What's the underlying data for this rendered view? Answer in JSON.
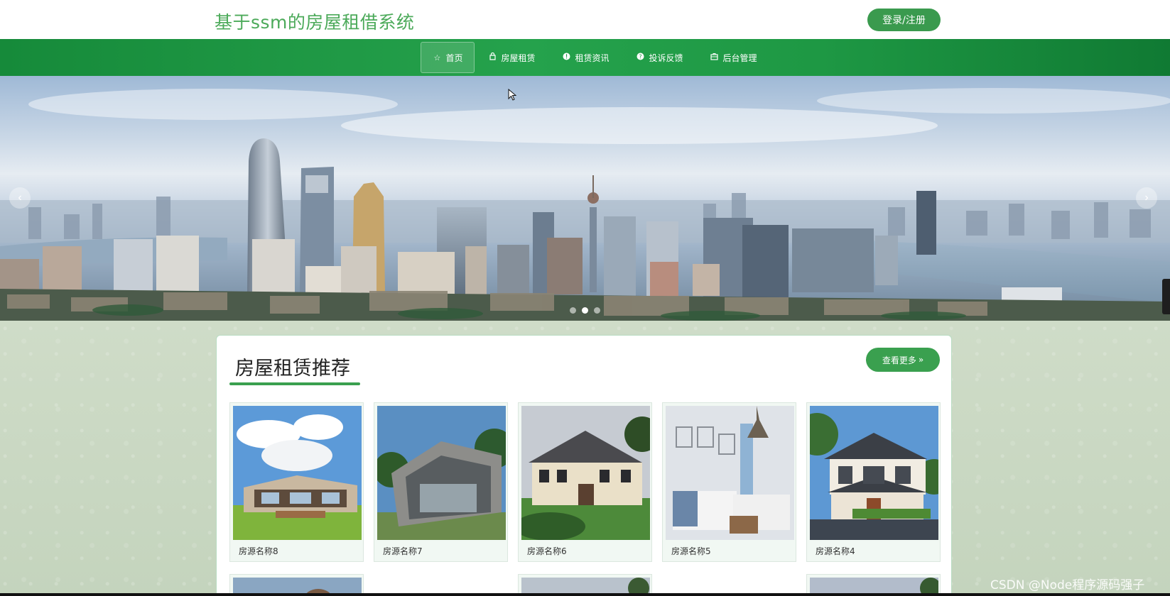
{
  "header": {
    "site_title": "基于ssm的房屋租借系统",
    "login_label": "登录/注册"
  },
  "nav": {
    "items": [
      {
        "label": "首页",
        "icon": "star-icon",
        "active": true
      },
      {
        "label": "房屋租赁",
        "icon": "bag-icon",
        "active": false
      },
      {
        "label": "租赁资讯",
        "icon": "info-icon",
        "active": false
      },
      {
        "label": "投诉反馈",
        "icon": "question-icon",
        "active": false
      },
      {
        "label": "后台管理",
        "icon": "briefcase-icon",
        "active": false
      }
    ]
  },
  "banner": {
    "prev_label": "‹",
    "next_label": "›",
    "slide_count": 3,
    "active_slide": 2
  },
  "recommend": {
    "title": "房屋租赁推荐",
    "more_label": "查看更多",
    "cards": [
      {
        "name": "房源名称8"
      },
      {
        "name": "房源名称7"
      },
      {
        "name": "房源名称6"
      },
      {
        "name": "房源名称5"
      },
      {
        "name": "房源名称4"
      }
    ]
  },
  "watermark": "CSDN @Node程序源码强子",
  "colors": {
    "brand_green": "#3aa04f",
    "nav_green": "#1e9844",
    "title_green": "#4caa5a"
  }
}
